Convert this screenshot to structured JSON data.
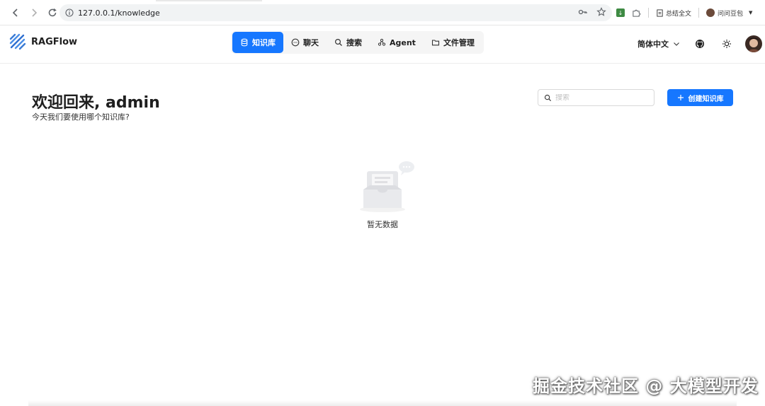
{
  "browser": {
    "url": "127.0.0.1/knowledge",
    "summary_label": "总结全文",
    "profile_name": "问问豆包"
  },
  "app": {
    "brand": "RAGFlow",
    "nav": [
      {
        "label": "知识库",
        "icon": "database-icon",
        "active": true
      },
      {
        "label": "聊天",
        "icon": "chat-icon",
        "active": false
      },
      {
        "label": "搜索",
        "icon": "search-icon",
        "active": false
      },
      {
        "label": "Agent",
        "icon": "agent-icon",
        "active": false
      },
      {
        "label": "文件管理",
        "icon": "folder-icon",
        "active": false
      }
    ],
    "language": "简体中文",
    "accent_color": "#1677ff"
  },
  "main": {
    "welcome": "欢迎回来, admin",
    "subtitle": "今天我们要使用哪个知识库?",
    "search_placeholder": "搜索",
    "create_button": "创建知识库",
    "empty_text": "暂无数据"
  },
  "watermark": "掘金技术社区 @ 大模型开发"
}
